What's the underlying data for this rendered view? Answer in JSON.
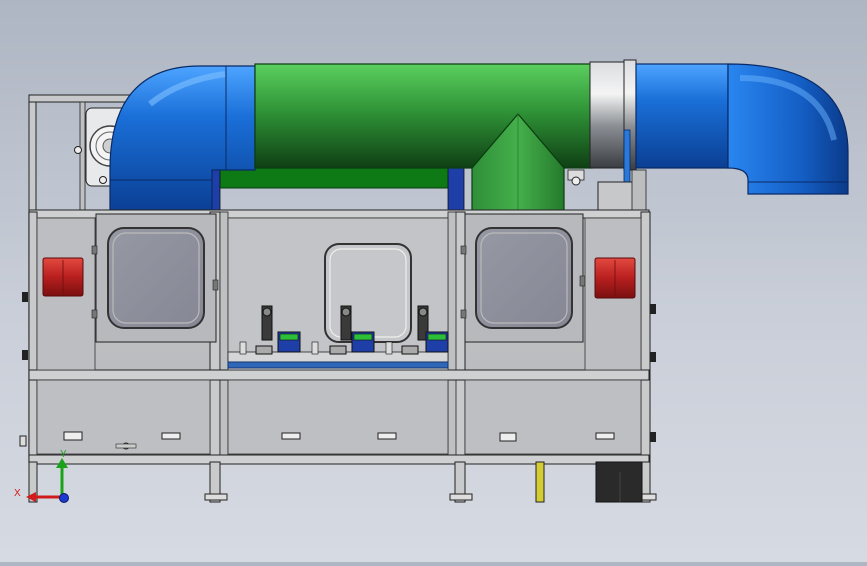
{
  "app": {
    "background_top": "#aeb6c3",
    "background_bottom": "#d6dae2"
  },
  "model": {
    "view": "front",
    "colors": {
      "duct_blue": "#1a6fd8",
      "duct_green": "#3aa445",
      "duct_steel": "#9ea3a8",
      "frame_grey": "#c6c7c8",
      "panel_grey": "#b9bbbe",
      "warning_red": "#c62828",
      "window_grey": "#8d8f9b",
      "post_yellow": "#d4cc33",
      "dark_box": "#2a2a2a"
    },
    "triad": {
      "x_label": "X",
      "y_label": "Y",
      "x_color": "#d11b1b",
      "y_color": "#1aa31a",
      "z_color": "#1a3ad1"
    },
    "fixtures": [
      "fixture-1",
      "fixture-2",
      "fixture-3"
    ]
  }
}
